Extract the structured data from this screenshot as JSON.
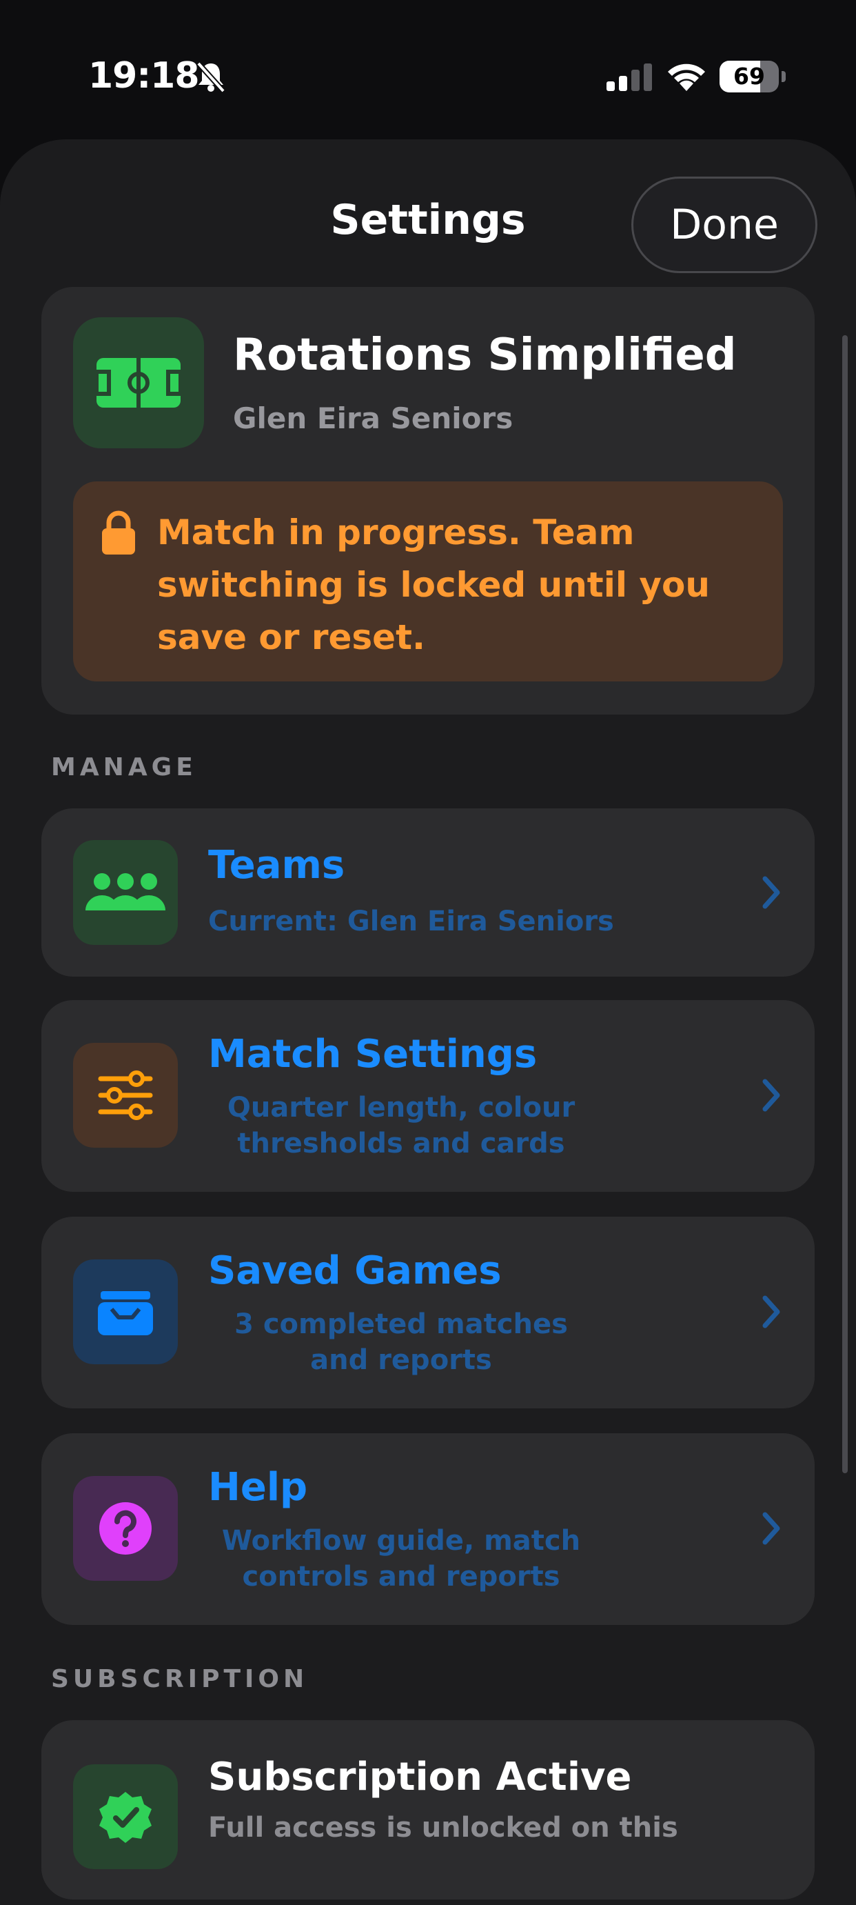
{
  "status_bar": {
    "time": "19:18",
    "battery": "69",
    "battery_level": 0.69
  },
  "header": {
    "title": "Settings",
    "done_label": "Done"
  },
  "app_card": {
    "name": "Rotations Simplified",
    "team": "Glen Eira Seniors",
    "lock_message": "Match in progress. Team switching is locked until you save or reset."
  },
  "sections": {
    "manage": "MANAGE",
    "subscription": "SUBSCRIPTION"
  },
  "manage_items": [
    {
      "title": "Teams",
      "subtitle": "Current: Glen Eira Seniors",
      "icon": "people-icon",
      "color": "#30d158"
    },
    {
      "title": "Match Settings",
      "subtitle": "Quarter length, colour thresholds and cards",
      "icon": "sliders-icon",
      "color": "#ff9f0a"
    },
    {
      "title": "Saved Games",
      "subtitle": "3 completed matches and reports",
      "icon": "archive-tray-icon",
      "color": "#0a84ff"
    },
    {
      "title": "Help",
      "subtitle": "Workflow guide, match controls and reports",
      "icon": "question-icon",
      "color": "#e040fb"
    }
  ],
  "subscription": {
    "title": "Subscription Active",
    "subtitle": "Full access is unlocked on this",
    "icon": "checkmark-seal-icon"
  },
  "colors": {
    "accent": "#1a8cff",
    "warning": "#ff9a32",
    "background": "#1c1c1e"
  }
}
